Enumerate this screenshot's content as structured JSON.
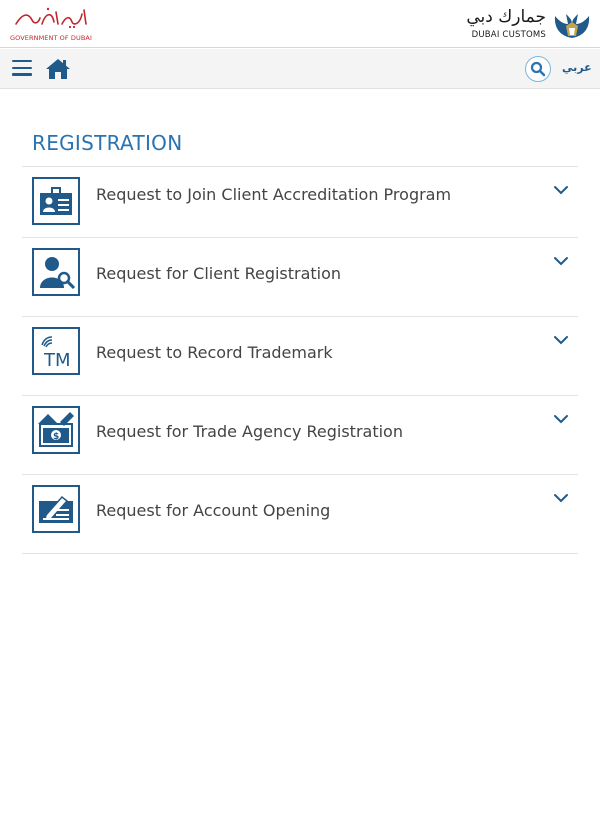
{
  "header": {
    "gov_logo_text_ar": "حكومة دبي",
    "gov_logo_text_en": "GOVERNMENT OF DUBAI",
    "customs_logo_text_ar": "جمارك دبي",
    "customs_logo_text_en": "DUBAI CUSTOMS"
  },
  "nav": {
    "menu_icon": "hamburger-icon",
    "home_icon": "home-icon",
    "search_icon": "search-icon",
    "language_label": "عربي"
  },
  "section": {
    "title": "REGISTRATION"
  },
  "services": [
    {
      "label": "Request to Join Client Accreditation Program",
      "icon": "id-card-icon"
    },
    {
      "label": "Request for Client Registration",
      "icon": "user-key-icon"
    },
    {
      "label": "Request to Record Trademark",
      "icon": "trademark-icon"
    },
    {
      "label": "Request for Trade Agency Registration",
      "icon": "agency-money-icon"
    },
    {
      "label": "Request for Account Opening",
      "icon": "account-form-icon"
    }
  ],
  "colors": {
    "brand_blue": "#1f5a8a",
    "title_blue": "#2a73b0",
    "gov_red": "#c0272d",
    "text_gray": "#444444"
  }
}
